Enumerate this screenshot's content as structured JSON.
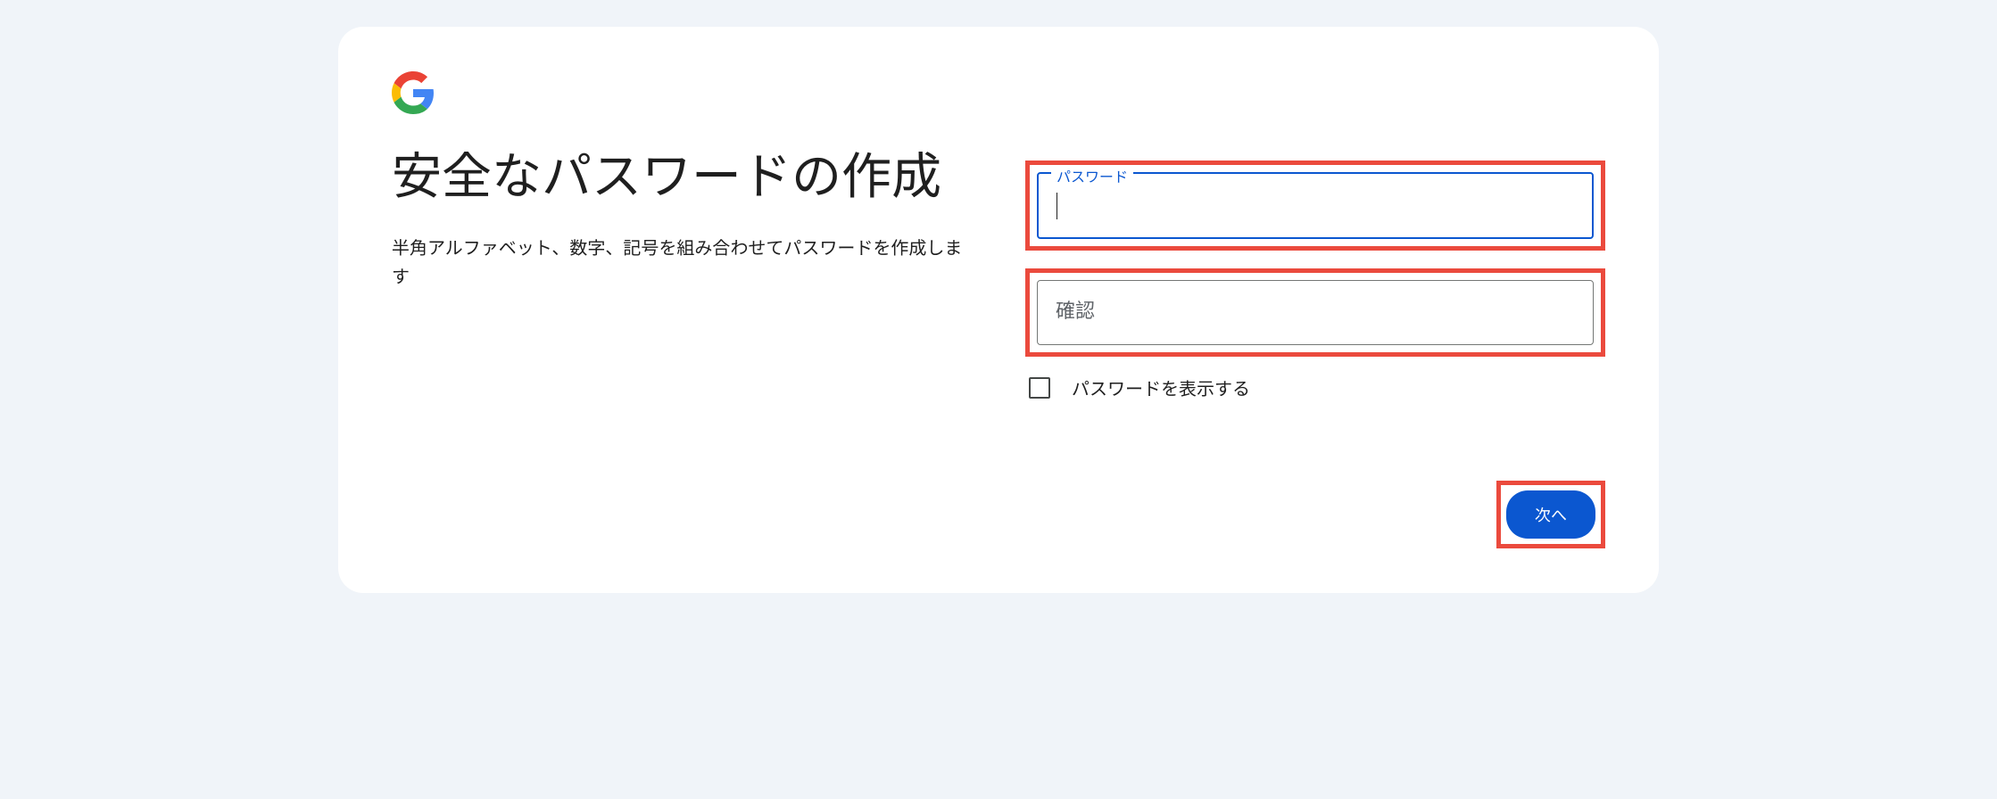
{
  "heading": {
    "title": "安全なパスワードの作成",
    "description": "半角アルファベット、数字、記号を組み合わせてパスワードを作成します"
  },
  "form": {
    "password_label": "パスワード",
    "password_value": "",
    "confirm_placeholder": "確認",
    "confirm_value": "",
    "show_password_label": "パスワードを表示する"
  },
  "actions": {
    "next_label": "次へ"
  }
}
